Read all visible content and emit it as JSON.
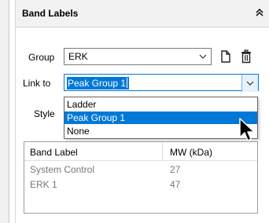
{
  "panel": {
    "title": "Band Labels",
    "collapse_icon": "double-chevron-up-icon"
  },
  "group": {
    "label": "Group",
    "value": "ERK",
    "new_icon": "new-document-icon",
    "delete_icon": "trash-icon"
  },
  "link_to": {
    "label": "Link to",
    "value": "Peak Group 1"
  },
  "style": {
    "label": "Style"
  },
  "dropdown": {
    "options": [
      "Ladder",
      "Peak Group 1",
      "None"
    ],
    "selected": "Peak Group 1"
  },
  "table": {
    "columns": [
      "Band Label",
      "MW (kDa)"
    ],
    "rows": [
      {
        "label": "System Control",
        "mw": "27"
      },
      {
        "label": "ERK 1",
        "mw": "47"
      }
    ]
  },
  "colors": {
    "accent": "#0078d7",
    "header_bg": "#f2f2f2",
    "muted_text": "#777777"
  }
}
